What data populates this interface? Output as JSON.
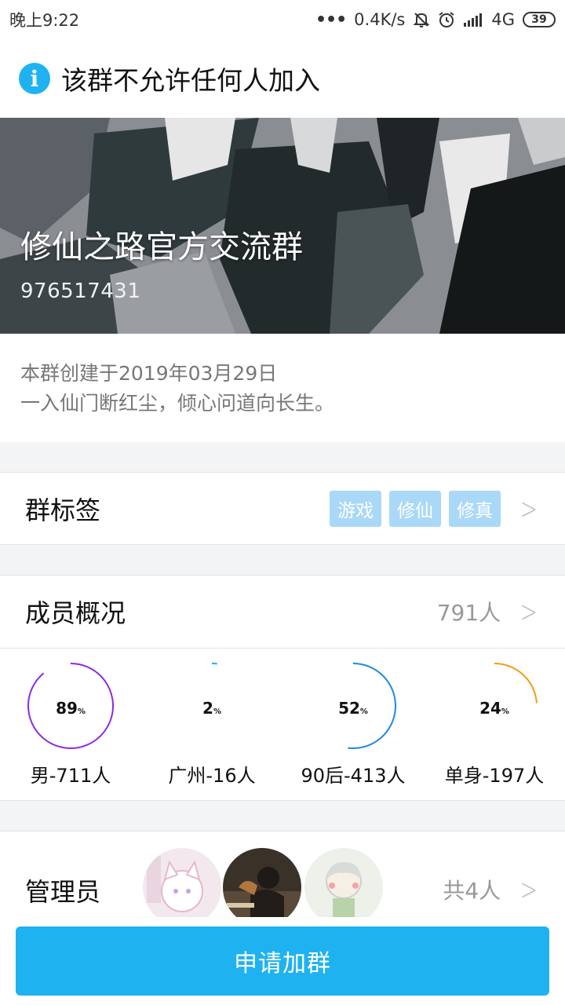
{
  "status": {
    "time": "晚上9:22",
    "more": "•••",
    "speed": "0.4K/s",
    "network": "4G",
    "battery": "39"
  },
  "notice": {
    "icon": "info-icon",
    "text": "该群不允许任何人加入"
  },
  "group": {
    "name": "修仙之路官方交流群",
    "id": "976517431",
    "created": "本群创建于2019年03月29日",
    "intro": "一入仙门断红尘，倾心问道向长生。"
  },
  "tags_row": {
    "title": "群标签",
    "tags": [
      "游戏",
      "修仙",
      "修真"
    ]
  },
  "members_row": {
    "title": "成员概况",
    "count": "791人"
  },
  "stats": [
    {
      "percent": 89,
      "unit": "%",
      "label": "男-711人",
      "color": "#8a2be2"
    },
    {
      "percent": 2,
      "unit": "%",
      "label": "广州-16人",
      "color": "#1fb2f0"
    },
    {
      "percent": 52,
      "unit": "%",
      "label": "90后-413人",
      "color": "#1e88e5"
    },
    {
      "percent": 24,
      "unit": "%",
      "label": "单身-197人",
      "color": "#f39c12"
    }
  ],
  "admins_row": {
    "title": "管理员",
    "count": "共4人"
  },
  "join_button": "申请加群",
  "colors": {
    "accent": "#1fb2f0",
    "tag": "#aad8f7"
  }
}
